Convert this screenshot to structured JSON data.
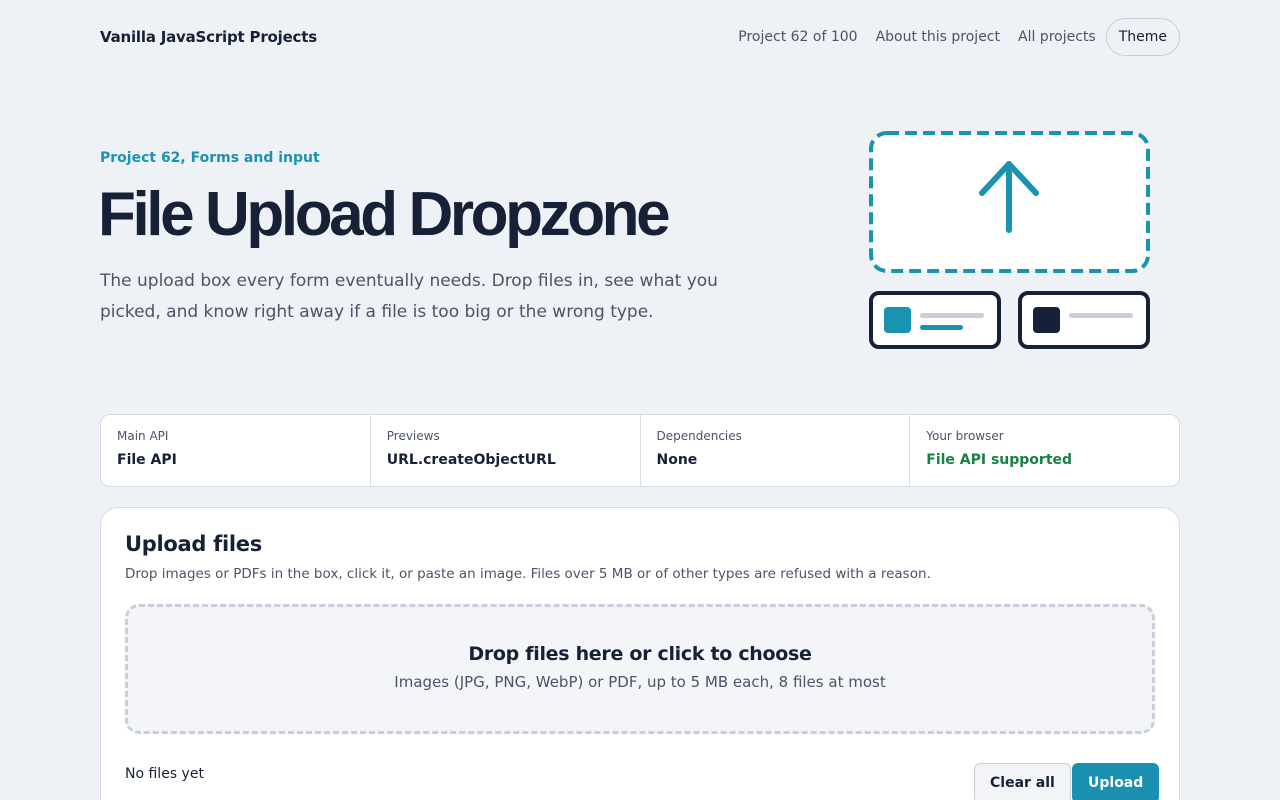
{
  "header": {
    "brand": "Vanilla JavaScript Projects",
    "nav": {
      "progress": "Project 62 of 100",
      "about": "About this project",
      "all": "All projects",
      "theme": "Theme"
    }
  },
  "hero": {
    "eyebrow": "Project 62, Forms and input",
    "title": "File Upload Dropzone",
    "description": "The upload box every form eventually needs. Drop files in, see what you picked, and know right away if a file is too big or the wrong type."
  },
  "stats": [
    {
      "label": "Main API",
      "value": "File API"
    },
    {
      "label": "Previews",
      "value": "URL.createObjectURL"
    },
    {
      "label": "Dependencies",
      "value": "None"
    },
    {
      "label": "Your browser",
      "value": "File API supported"
    }
  ],
  "upload": {
    "title": "Upload files",
    "description": "Drop images or PDFs in the box, click it, or paste an image. Files over 5 MB or of other types are refused with a reason.",
    "dropzone_title": "Drop files here or click to choose",
    "dropzone_hint": "Images (JPG, PNG, WebP) or PDF, up to 5 MB each, 8 files at most",
    "file_status": "No files yet",
    "clear_label": "Clear all",
    "upload_label": "Upload"
  },
  "colors": {
    "accent": "#1a93b0",
    "ink": "#162036",
    "success": "#178144",
    "background": "#eef1f5"
  },
  "icons": {
    "hero": "upload-arrow-icon"
  }
}
